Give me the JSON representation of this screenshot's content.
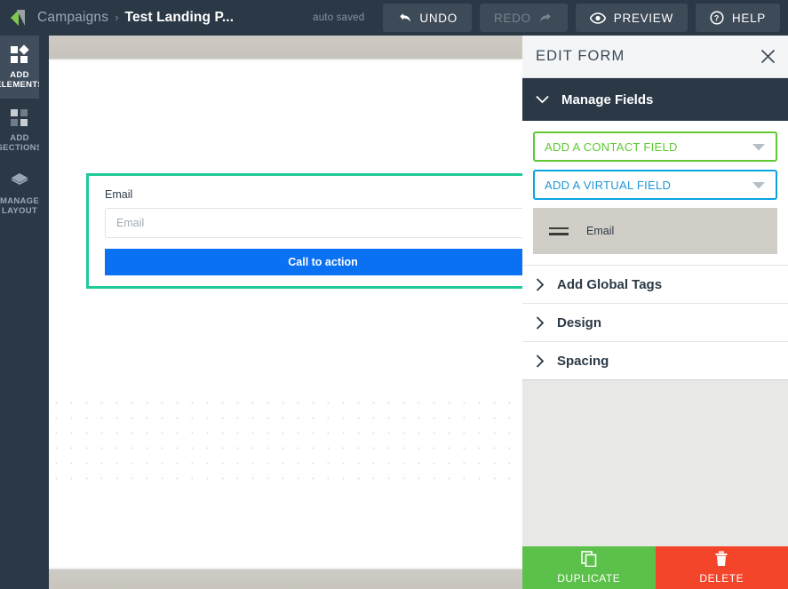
{
  "topbar": {
    "logo_icon": "brand-logo",
    "breadcrumb_parent": "Campaigns",
    "breadcrumb_separator": "›",
    "breadcrumb_current": "Test Landing P...",
    "autosaved": "auto saved",
    "buttons": [
      {
        "label": "UNDO",
        "icon": "undo-arrow-icon",
        "disabled": false
      },
      {
        "label": "REDO",
        "icon": "redo-arrow-icon",
        "disabled": true
      },
      {
        "label": "PREVIEW",
        "icon": "eye-icon",
        "disabled": false
      },
      {
        "label": "HELP",
        "icon": "question-circle-icon",
        "disabled": false
      }
    ]
  },
  "sidebar": {
    "items": [
      {
        "label": "ADD\nELEMENTS",
        "icon": "add-elements-icon",
        "active": true
      },
      {
        "label": "ADD\nSECTIONS",
        "icon": "add-sections-icon",
        "active": false
      },
      {
        "label": "MANAGE\nLAYOUT",
        "icon": "layers-icon",
        "active": false
      }
    ]
  },
  "canvas": {
    "form": {
      "field_label": "Email",
      "input_placeholder": "Email",
      "cta_label": "Call to action"
    }
  },
  "panel": {
    "title": "EDIT FORM",
    "close_icon": "close-icon",
    "manage_fields": {
      "label": "Manage Fields",
      "chevron_icon": "chevron-down-icon",
      "expanded": true
    },
    "selects": [
      {
        "label": "ADD A CONTACT FIELD",
        "color": "#5fc832",
        "caret_icon": "caret-down-icon"
      },
      {
        "label": "ADD A VIRTUAL FIELD",
        "color": "#0aa3e0",
        "caret_icon": "caret-down-icon"
      }
    ],
    "fields": [
      {
        "name": "Email",
        "handle_icon": "drag-handle-icon"
      }
    ],
    "sections": [
      {
        "label": "Add Global Tags",
        "chevron_icon": "chevron-right-icon",
        "expanded": false
      },
      {
        "label": "Design",
        "chevron_icon": "chevron-right-icon",
        "expanded": false
      },
      {
        "label": "Spacing",
        "chevron_icon": "chevron-right-icon",
        "expanded": false
      }
    ],
    "actions": [
      {
        "label": "DUPLICATE",
        "icon": "copy-icon",
        "color": "#5cc14a"
      },
      {
        "label": "DELETE",
        "icon": "trash-icon",
        "color": "#f4452a"
      }
    ]
  }
}
